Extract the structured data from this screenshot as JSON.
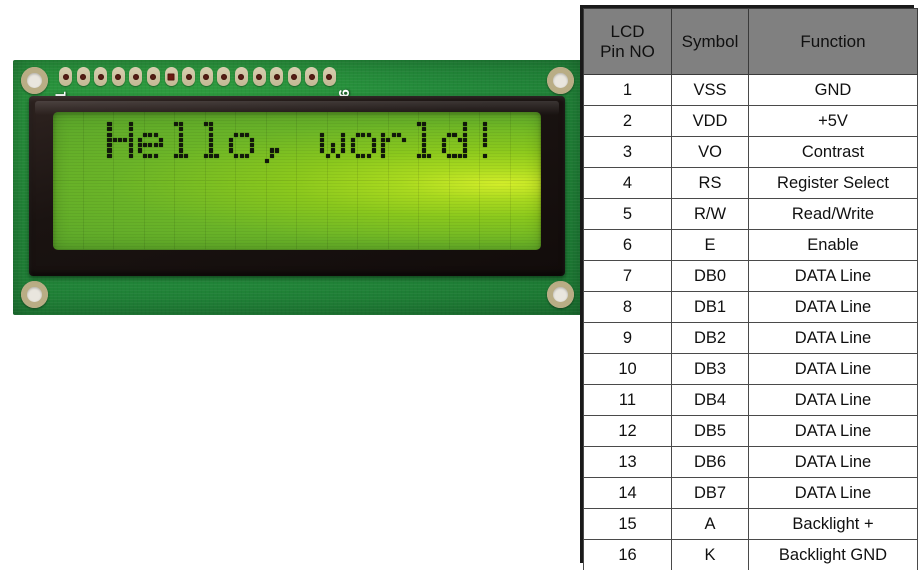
{
  "lcd_module": {
    "label": "16x2 character LCD module",
    "pin_label_first": "1",
    "pin_label_last": "16",
    "pin_count": 16,
    "display_text": "Hello, world!",
    "display_columns": 16,
    "display_rows": 2,
    "colors": {
      "pcb_green": "#23893a",
      "backlight_green": "#8ac81d",
      "backlight_bright": "#d3ee2a",
      "bezel_black": "#1a1311",
      "pixel_dark": "#12180a",
      "pad_gold": "#c9bf9c",
      "label_white": "#ffffff"
    }
  },
  "pinout_table": {
    "headers": [
      "LCD Pin NO",
      "Symbol",
      "Function"
    ],
    "header_line1": "LCD",
    "header_line2": "Pin NO",
    "header_bg": "#808080",
    "rows": [
      {
        "pin": "1",
        "symbol": "VSS",
        "function": "GND"
      },
      {
        "pin": "2",
        "symbol": "VDD",
        "function": "+5V"
      },
      {
        "pin": "3",
        "symbol": "VO",
        "function": "Contrast"
      },
      {
        "pin": "4",
        "symbol": "RS",
        "function": "Register Select"
      },
      {
        "pin": "5",
        "symbol": "R/W",
        "function": "Read/Write"
      },
      {
        "pin": "6",
        "symbol": "E",
        "function": "Enable"
      },
      {
        "pin": "7",
        "symbol": "DB0",
        "function": "DATA Line"
      },
      {
        "pin": "8",
        "symbol": "DB1",
        "function": "DATA Line"
      },
      {
        "pin": "9",
        "symbol": "DB2",
        "function": "DATA Line"
      },
      {
        "pin": "10",
        "symbol": "DB3",
        "function": "DATA Line"
      },
      {
        "pin": "11",
        "symbol": "DB4",
        "function": "DATA Line"
      },
      {
        "pin": "12",
        "symbol": "DB5",
        "function": "DATA Line"
      },
      {
        "pin": "13",
        "symbol": "DB6",
        "function": "DATA Line"
      },
      {
        "pin": "14",
        "symbol": "DB7",
        "function": "DATA Line"
      },
      {
        "pin": "15",
        "symbol": "A",
        "function": "Backlight +"
      },
      {
        "pin": "16",
        "symbol": "K",
        "function": "Backlight GND"
      }
    ]
  }
}
